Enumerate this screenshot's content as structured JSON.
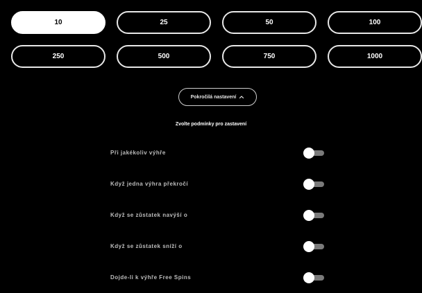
{
  "amounts": {
    "selected": "10",
    "options": [
      "10",
      "25",
      "50",
      "100",
      "250",
      "500",
      "750",
      "1000"
    ]
  },
  "advanced_settings": {
    "label": "Pokročilá nastavení",
    "icon": "chevron-up-icon",
    "expanded": true
  },
  "stop_conditions": {
    "heading": "Zvolte podmínky pro zastavení",
    "items": [
      {
        "label": "Při jakékoliv výhře",
        "enabled": false
      },
      {
        "label": "Když jedna výhra překročí",
        "enabled": false
      },
      {
        "label": "Když se zůstatek navýší o",
        "enabled": false
      },
      {
        "label": "Když se zůstatek sníží o",
        "enabled": false
      },
      {
        "label": "Dojde-li k výhře Free Spins",
        "enabled": false
      }
    ]
  },
  "colors": {
    "background": "#000000",
    "selected_pill": "#ffffff",
    "pill_border": "#e8e8e8",
    "toggle_track": "#7a7a7a",
    "toggle_knob": "#ffffff"
  }
}
